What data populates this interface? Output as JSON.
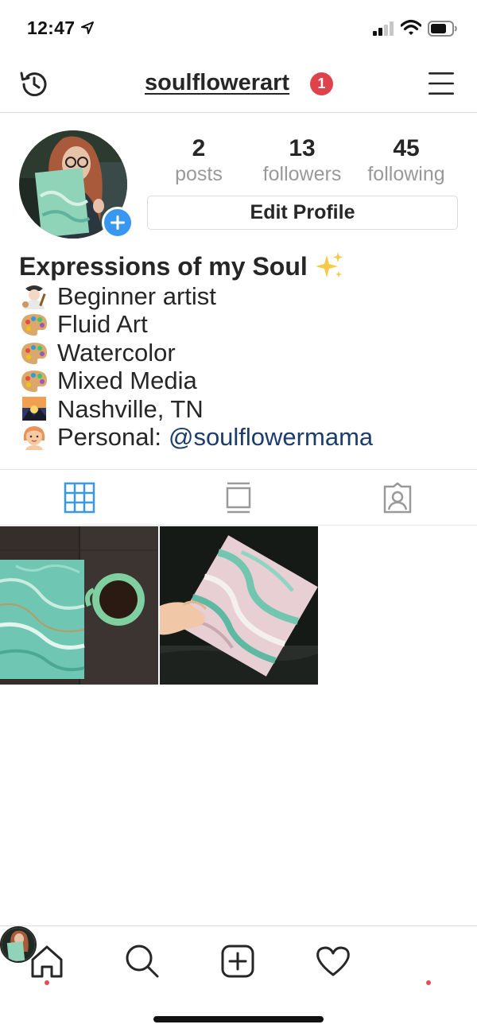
{
  "status_bar": {
    "time": "12:47"
  },
  "header": {
    "username": "soulflowerart",
    "notification_count": "1"
  },
  "stats": {
    "posts": {
      "value": "2",
      "label": "posts"
    },
    "followers": {
      "value": "13",
      "label": "followers"
    },
    "following": {
      "value": "45",
      "label": "following"
    }
  },
  "edit_profile_label": "Edit Profile",
  "bio": {
    "name": "Expressions of my Soul",
    "lines": [
      {
        "icon": "artist-icon",
        "text": "Beginner artist"
      },
      {
        "icon": "palette-icon",
        "text": "Fluid Art"
      },
      {
        "icon": "palette-icon",
        "text": "Watercolor"
      },
      {
        "icon": "palette-icon",
        "text": "Mixed Media"
      },
      {
        "icon": "sunset-icon",
        "text": "Nashville, TN"
      },
      {
        "icon": "person-icon",
        "text": "Personal:"
      }
    ],
    "personal_link": "@soulflowermama"
  },
  "tabs": [
    "grid-icon",
    "feed-icon",
    "tagged-icon"
  ],
  "colors": {
    "accent_blue": "#3897f0",
    "badge_red": "#e0424b",
    "link": "#1c3d6c"
  }
}
